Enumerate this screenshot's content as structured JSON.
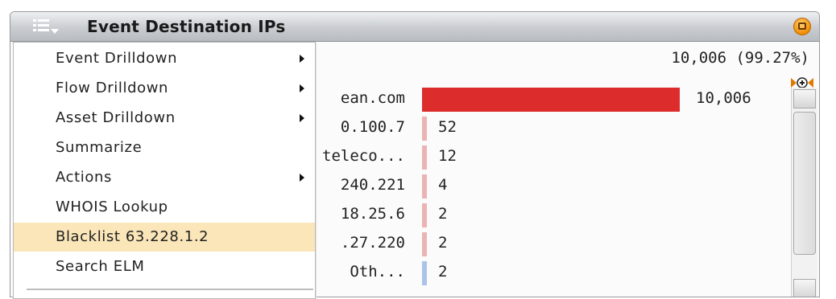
{
  "widget": {
    "title": "Event Destination IPs",
    "total": "10,006 (99.27%)"
  },
  "rows": [
    {
      "label": "ean.com",
      "value": "10,006",
      "count": 10006,
      "color": "#dd2c2c"
    },
    {
      "label": "0.100.7",
      "value": "52",
      "count": 52,
      "color": "#eab4b4"
    },
    {
      "label": "teleco...",
      "value": "12",
      "count": 12,
      "color": "#eab4b4"
    },
    {
      "label": "240.221",
      "value": "4",
      "count": 4,
      "color": "#eab4b4"
    },
    {
      "label": "18.25.6",
      "value": "2",
      "count": 2,
      "color": "#eab4b4"
    },
    {
      "label": ".27.220",
      "value": "2",
      "count": 2,
      "color": "#eab4b4"
    },
    {
      "label": "Oth...",
      "value": "2",
      "count": 2,
      "color": "#aac4e8"
    }
  ],
  "context_menu": {
    "items": [
      {
        "label": "Event Drilldown",
        "submenu": true,
        "highlight": false
      },
      {
        "label": "Flow Drilldown",
        "submenu": true,
        "highlight": false
      },
      {
        "label": "Asset Drilldown",
        "submenu": true,
        "highlight": false
      },
      {
        "label": "Summarize",
        "submenu": false,
        "highlight": false
      },
      {
        "label": "Actions",
        "submenu": true,
        "highlight": false
      },
      {
        "label": "WHOIS Lookup",
        "submenu": false,
        "highlight": false
      },
      {
        "label": "Blacklist 63.228.1.2",
        "submenu": false,
        "highlight": true
      },
      {
        "label": "Search ELM",
        "submenu": false,
        "highlight": false
      }
    ]
  },
  "colors": {
    "highlight": "#fae6b8",
    "bar_primary": "#dd2c2c",
    "bar_secondary": "#eab4b4",
    "accent_orange": "#f08c00"
  },
  "icons": {
    "menu": "list-dropdown-icon",
    "close": "minimize-icon",
    "expand": "expand-icon",
    "cursor": "resize-cursor-icon"
  }
}
